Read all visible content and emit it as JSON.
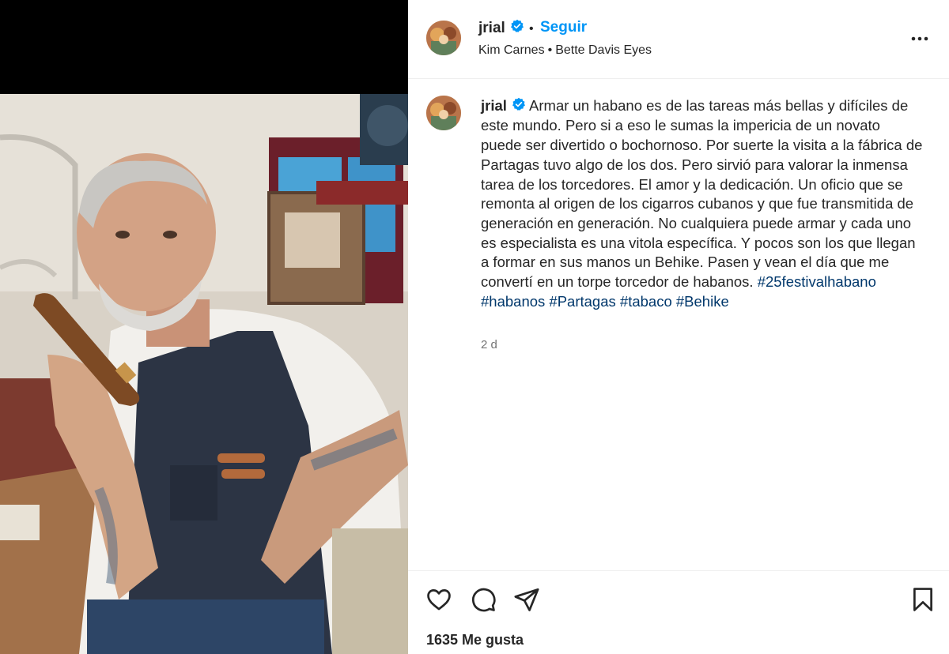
{
  "post": {
    "username": "jrial",
    "follow_label": "Seguir",
    "dot": "•",
    "music": {
      "artist": "Kim Carnes",
      "separator": "•",
      "song": "Bette Davis Eyes"
    },
    "caption_username": "jrial",
    "caption_text": "Armar un habano es de las tareas más bellas y difíciles de este mundo. Pero si a eso le sumas la impericia de un novato puede ser divertido o bochornoso. Por suerte la visita a la fábrica de Partagas tuvo algo de los dos. Pero sirvió para valorar la inmensa tarea de los torcedores. El amor y la dedicación. Un oficio que se remonta al origen de los cigarros cubanos y que fue transmitida de generación en generación. No cualquiera puede armar y cada uno es especialista es una vitola específica. Y pocos son los que llegan a formar en sus manos un Behike. Pasen y vean el día que me convertí en un torpe torcedor de habanos.",
    "hashtags": [
      "#25festivalhabano",
      "#habanos",
      "#Partagas",
      "#tabaco",
      "#Behike"
    ],
    "time_ago": "2 d",
    "likes_text": "1635 Me gusta"
  },
  "icons": {
    "verified": "verified-badge-icon",
    "more": "more-options-icon",
    "like": "heart-icon",
    "comment": "comment-icon",
    "share": "send-icon",
    "save": "bookmark-icon"
  },
  "colors": {
    "link_blue": "#0095f6",
    "hashtag": "#00376b",
    "text": "#262626",
    "muted": "#737373",
    "verified": "#0095f6"
  }
}
